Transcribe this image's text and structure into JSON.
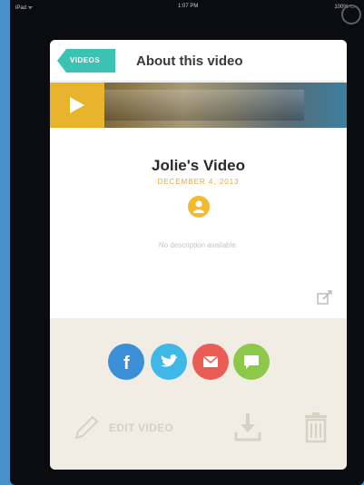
{
  "status_bar": {
    "carrier": "iPad ᯤ",
    "time": "1:07 PM",
    "battery": "100% ▭"
  },
  "nav": {
    "back_label": "VIDEOS",
    "title": "About this video"
  },
  "video": {
    "title": "Jolie's Video",
    "date": "DECEMBER 4, 2013",
    "description": "No description available."
  },
  "actions": {
    "edit_label": "EDIT VIDEO"
  },
  "colors": {
    "accent_teal": "#3cc2b4",
    "date_orange": "#e9a83c",
    "play_yellow": "#e8b42e",
    "facebook": "#3b8fd6",
    "twitter": "#3fb8e8",
    "email": "#e95d54",
    "message": "#8dc84b",
    "actions_bg": "#f1ede4"
  },
  "icons": [
    "back-arrow-icon",
    "play-icon",
    "user-icon",
    "edit-link-icon",
    "facebook-icon",
    "twitter-icon",
    "email-icon",
    "message-icon",
    "pencil-icon",
    "download-icon",
    "trash-icon"
  ]
}
